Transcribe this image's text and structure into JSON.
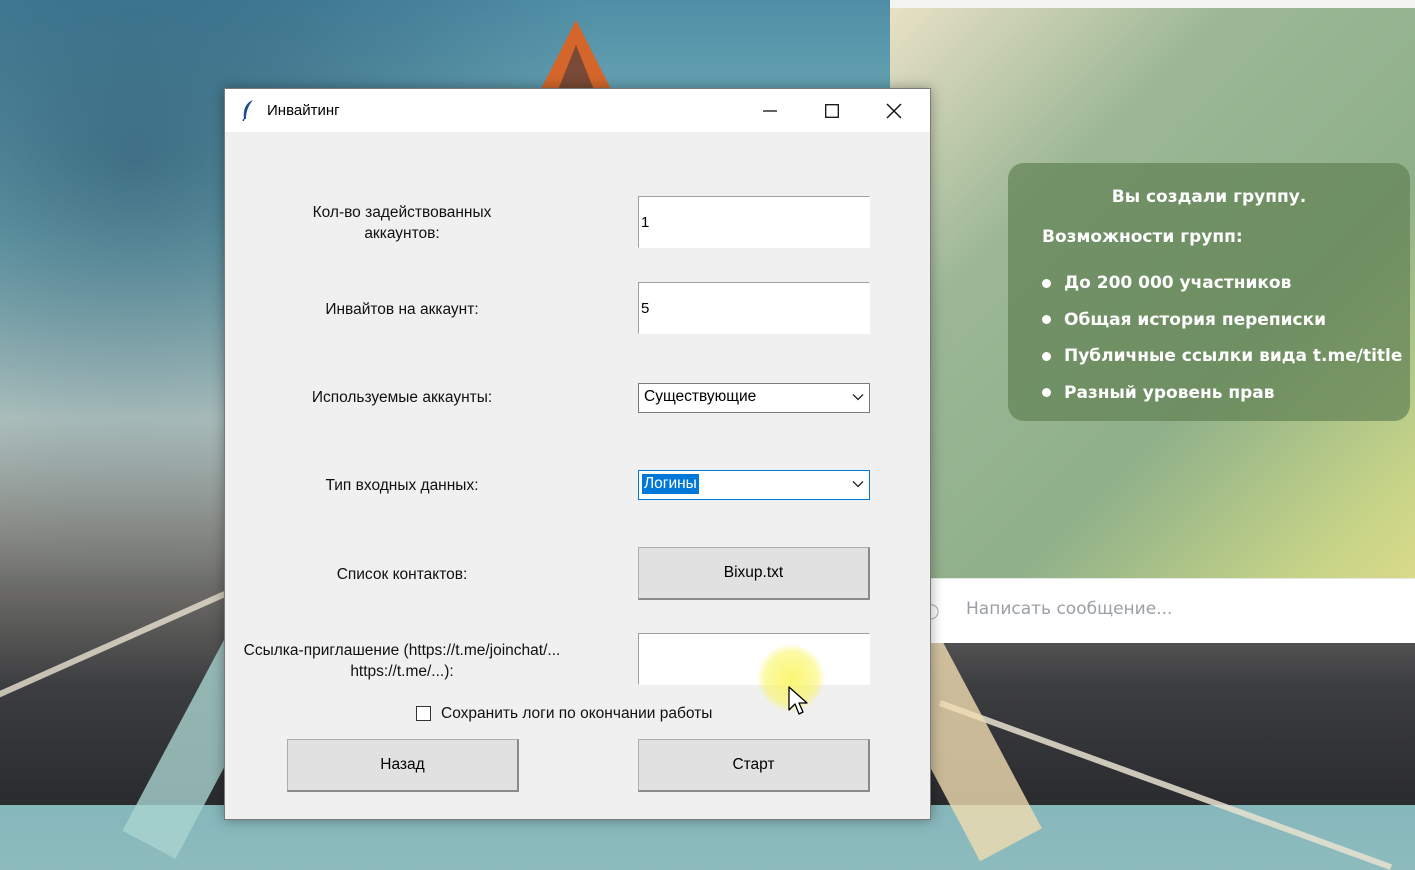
{
  "dialog": {
    "title": "Инвайтинг",
    "fields": {
      "accounts_count_label": "Кол-во задействованных аккаунтов:",
      "accounts_count_value": "1",
      "invites_per_account_label": "Инвайтов на аккаунт:",
      "invites_per_account_value": "5",
      "used_accounts_label": "Используемые аккаунты:",
      "used_accounts_value": "Существующие",
      "input_type_label": "Тип входных данных:",
      "input_type_value": "Логины",
      "contacts_label": "Список контактов:",
      "contacts_file": "Bixup.txt",
      "invite_link_label": "Ссылка-приглашение (https://t.me/joinchat/... https://t.me/...):",
      "invite_link_value": ""
    },
    "save_logs_label": "Сохранить логи по окончании работы",
    "save_logs_checked": false,
    "back_button": "Назад",
    "start_button": "Старт"
  },
  "telegram": {
    "service_title": "Вы создали группу.",
    "service_subtitle": "Возможности групп:",
    "features": [
      "До 200 000 участников",
      "Общая история переписки",
      "Публичные ссылки вида t.me/title",
      "Разный уровень прав"
    ],
    "compose_placeholder": "Написать сообщение..."
  },
  "icons": {
    "app": "feather-icon",
    "minimize": "minimize-icon",
    "maximize": "maximize-icon",
    "close": "close-icon",
    "dropdown": "chevron-down-icon",
    "attach": "paperclip-icon",
    "cursor": "mouse-pointer-icon"
  }
}
